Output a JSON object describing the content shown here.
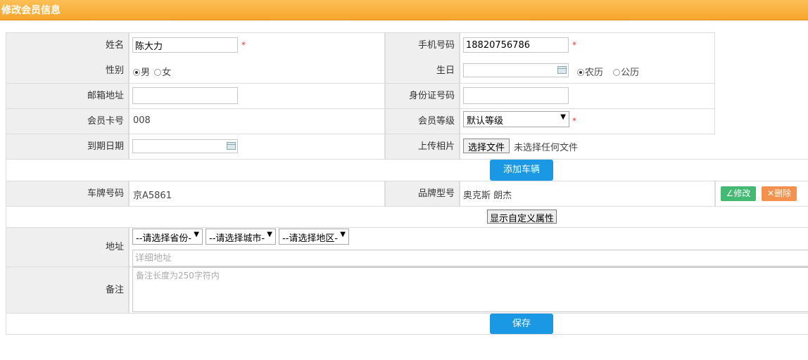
{
  "page": {
    "title": "修改会员信息"
  },
  "form": {
    "name": {
      "label": "姓名",
      "value": "陈大力",
      "required": "*"
    },
    "phone": {
      "label": "手机号码",
      "value": "18820756786",
      "required": "*"
    },
    "gender": {
      "label": "性别",
      "male": "男",
      "female": "女",
      "selected": "男"
    },
    "birthday": {
      "label": "生日",
      "value": "",
      "lunar": "农历",
      "solar": "公历",
      "selected": "农历"
    },
    "email": {
      "label": "邮箱地址",
      "value": ""
    },
    "id_card": {
      "label": "身份证号码",
      "value": ""
    },
    "card_no": {
      "label": "会员卡号",
      "value": "008"
    },
    "level": {
      "label": "会员等级",
      "value": "默认等级",
      "required": "*"
    },
    "expire": {
      "label": "到期日期",
      "value": ""
    },
    "photo": {
      "label": "上传相片",
      "button": "选择文件",
      "status": "未选择任何文件"
    },
    "add_vehicle": "添加车辆",
    "vehicle": {
      "plate_label": "车牌号码",
      "plate": "京A5861",
      "brand_label": "品牌型号",
      "brand": "奥克斯 朗杰",
      "edit": "修改",
      "delete": "删除"
    },
    "custom_attrs": "显示自定义属性",
    "address": {
      "label": "地址",
      "province": "--请选择省份-",
      "city": "--请选择城市-",
      "district": "--请选择地区-",
      "detail_placeholder": "详细地址"
    },
    "remark": {
      "label": "备注",
      "placeholder": "备注长度为250字符内"
    },
    "save": "保存"
  },
  "icons": {
    "edit": "edit-icon",
    "delete": "close-icon",
    "calendar": "calendar-icon"
  }
}
